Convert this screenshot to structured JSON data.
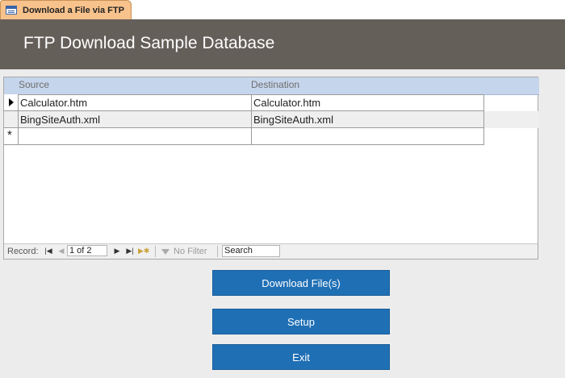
{
  "tab": {
    "label": "Download a File via FTP",
    "icon": "form-icon"
  },
  "header": {
    "title": "FTP Download Sample Database"
  },
  "datasheet": {
    "columns": [
      "Source",
      "Destination"
    ],
    "rows": [
      {
        "source": "Calculator.htm",
        "destination": "Calculator.htm"
      },
      {
        "source": "BingSiteAuth.xml",
        "destination": "BingSiteAuth.xml"
      }
    ],
    "new_row_marker": "*"
  },
  "navbar": {
    "record_label": "Record:",
    "position": "1 of 2",
    "filter_label": "No Filter",
    "search_placeholder": "Search",
    "icons": [
      "first-record-icon",
      "previous-record-icon",
      "next-record-icon",
      "last-record-icon",
      "new-record-icon",
      "filter-icon"
    ]
  },
  "buttons": {
    "download": "Download File(s)",
    "setup": "Setup",
    "exit": "Exit"
  },
  "colors": {
    "header_bg": "#655f5a",
    "tab_bg": "#f7c28c",
    "button_bg": "#1f6fb5",
    "column_header_bg": "#c5d5ec"
  }
}
